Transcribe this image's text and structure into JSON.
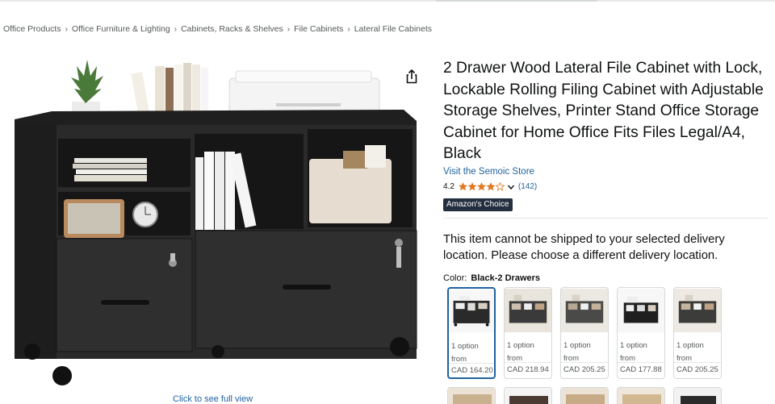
{
  "breadcrumb": [
    "Office Products",
    "Office Furniture & Lighting",
    "Cabinets, Racks & Shelves",
    "File Cabinets",
    "Lateral File Cabinets"
  ],
  "breadcrumb_separator": "›",
  "image": {
    "full_view_label": "Click to see full view"
  },
  "product": {
    "title": "2 Drawer Wood Lateral File Cabinet with Lock, Lockable Rolling Filing Cabinet with Adjustable Storage Shelves, Printer Stand Office Storage Cabinet for Home Office Fits Files Legal/A4, Black",
    "store_link": "Visit the Semoic Store",
    "rating": "4.2",
    "rating_count": "(142)",
    "badge": "Amazon's Choice",
    "shipping_message": "This item cannot be shipped to your selected delivery location. Please choose a different delivery location."
  },
  "color": {
    "label": "Color:",
    "selected": "Black-2 Drawers",
    "options": [
      {
        "line1": "1 option",
        "line2": "from",
        "price": "CAD 164.20"
      },
      {
        "line1": "1 option",
        "line2": "from",
        "price": "CAD 218.94"
      },
      {
        "line1": "1 option",
        "line2": "from",
        "price": "CAD 205.25"
      },
      {
        "line1": "1 option",
        "line2": "from",
        "price": "CAD 177.88"
      },
      {
        "line1": "1 option",
        "line2": "from",
        "price": "CAD 205.25"
      }
    ]
  },
  "colors": {
    "link": "#2162a1",
    "badge_bg": "#232f3e",
    "star": "#de7921",
    "cabinet": "#2a2a2a"
  },
  "icons": [
    "share-icon",
    "star-icon",
    "chevron-down-icon"
  ]
}
